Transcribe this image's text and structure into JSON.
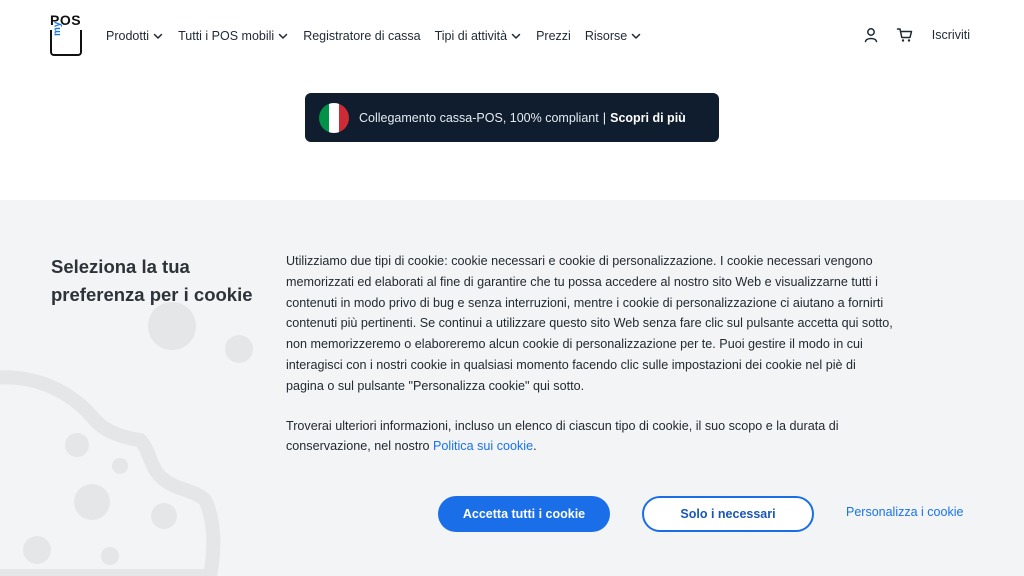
{
  "header": {
    "logo_text": "POS",
    "logo_sub": "my",
    "nav": [
      {
        "label": "Prodotti",
        "has_dropdown": true
      },
      {
        "label": "Tutti i POS mobili",
        "has_dropdown": true
      },
      {
        "label": "Registratore di cassa",
        "has_dropdown": false
      },
      {
        "label": "Tipi di attività",
        "has_dropdown": true
      },
      {
        "label": "Prezzi",
        "has_dropdown": false
      },
      {
        "label": "Risorse",
        "has_dropdown": true
      }
    ],
    "account_icon": "user-icon",
    "cart_icon": "cart-icon",
    "signup_label": "Iscriviti"
  },
  "banner": {
    "flag_colors": [
      "#009246",
      "#ffffff",
      "#ce2b37"
    ],
    "text": "Collegamento cassa-POS, 100% compliant",
    "separator": "|",
    "link_label": "Scopri di più"
  },
  "cookie": {
    "title": "Seleziona la tua preferenza per i cookie",
    "paragraph1": "Utilizziamo due tipi di cookie: cookie necessari e cookie di personalizzazione. I cookie necessari vengono memorizzati ed elaborati al fine di garantire che tu possa accedere al nostro sito Web e visualizzarne tutti i contenuti in modo privo di bug e senza interruzioni, mentre i cookie di personalizzazione ci aiutano a fornirti contenuti più pertinenti. Se continui a utilizzare questo sito Web senza fare clic sul pulsante accetta qui sotto, non memorizzeremo o elaboreremo alcun cookie di personalizzazione per te. Puoi gestire il modo in cui interagisci con i nostri cookie in qualsiasi momento facendo clic sulle impostazioni dei cookie nel piè di pagina o sul pulsante \"Personalizza cookie\" qui sotto.",
    "paragraph2_before": "Troverai ulteriori informazioni, incluso un elenco di ciascun tipo di cookie, il suo scopo e la durata di conservazione, nel nostro ",
    "policy_link": "Politica sui cookie",
    "paragraph2_after": ".",
    "accept_all_label": "Accetta tutti i cookie",
    "necessary_label": "Solo i necessari",
    "customize_label": "Personalizza i cookie"
  },
  "colors": {
    "accent": "#1a6fe8",
    "banner_bg": "#0f1d2e",
    "panel_bg": "#f3f4f5"
  }
}
